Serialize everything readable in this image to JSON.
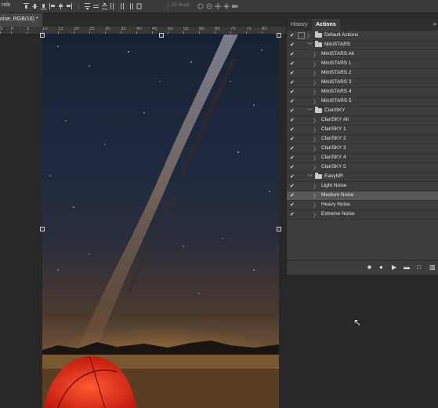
{
  "optbar": {
    "tool_label": "rols",
    "mode_label": "3D Mode"
  },
  "doc_tab": {
    "title": "oise, RGB/16) *"
  },
  "ruler": {
    "ticks": [
      "5",
      "0",
      "5",
      "10",
      "15",
      "20",
      "25",
      "30",
      "35",
      "40",
      "45",
      "50",
      "55",
      "60",
      "65",
      "70",
      "75",
      "80"
    ]
  },
  "panel": {
    "tabs": {
      "history": "History",
      "actions": "Actions"
    },
    "collapse": "»",
    "rows": [
      {
        "label": "Default Actions",
        "kind": "set",
        "open": false,
        "dialog": true
      },
      {
        "label": "MiniSTARS",
        "kind": "set",
        "open": true
      },
      {
        "label": "MiniSTARS All",
        "kind": "action"
      },
      {
        "label": "MiniSTARS 1",
        "kind": "action"
      },
      {
        "label": "MiniSTARS 2",
        "kind": "action"
      },
      {
        "label": "MiniSTARS 3",
        "kind": "action"
      },
      {
        "label": "MiniSTARS 4",
        "kind": "action"
      },
      {
        "label": "MiniSTARS 5",
        "kind": "action"
      },
      {
        "label": "ClariSKY",
        "kind": "set",
        "open": true
      },
      {
        "label": "ClariSKY All",
        "kind": "action"
      },
      {
        "label": "ClariSKY 1",
        "kind": "action"
      },
      {
        "label": "ClariSKY 2",
        "kind": "action"
      },
      {
        "label": "ClariSKY 3",
        "kind": "action"
      },
      {
        "label": "ClariSKY 4",
        "kind": "action"
      },
      {
        "label": "ClariSKY 5",
        "kind": "action"
      },
      {
        "label": "EasyNR",
        "kind": "set",
        "open": true
      },
      {
        "label": "Light Noise",
        "kind": "action"
      },
      {
        "label": "Medium Noise",
        "kind": "action",
        "selected": true
      },
      {
        "label": "Heavy Noise",
        "kind": "action"
      },
      {
        "label": "Extreme Noise",
        "kind": "action"
      }
    ]
  },
  "icons": {
    "check": "✔",
    "closed": "〉",
    "open": "﹀"
  },
  "colors": {
    "panel_bg": "#3c3c3c",
    "selected_row": "#575757",
    "tent": "#e0261a"
  }
}
